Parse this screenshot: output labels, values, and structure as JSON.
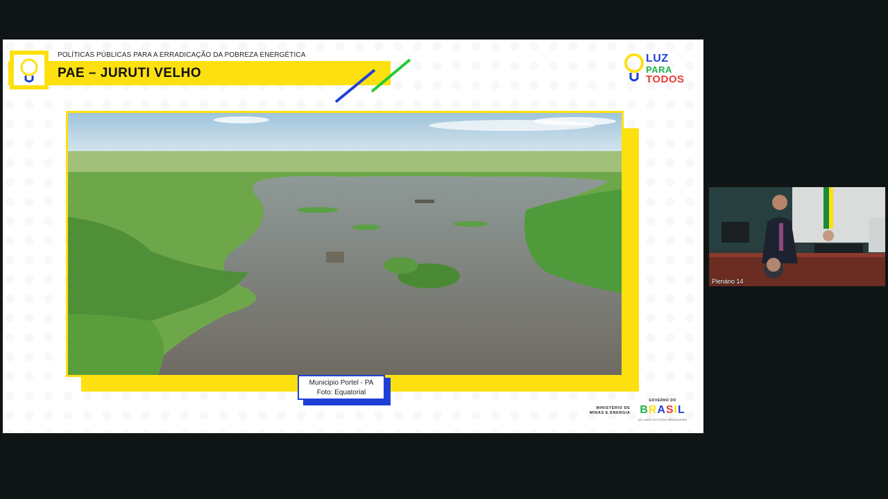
{
  "slide": {
    "subtitle": "POLÍTICAS PÚBLICAS PARA A ERRADICAÇÃO DA POBREZA ENERGÉTICA",
    "title": "PAE – JURUTI VELHO",
    "brand": {
      "line1": "LUZ",
      "line2": "PARA",
      "line3": "TODOS",
      "colors": {
        "blue": "#1e3fd6",
        "green": "#22b14c",
        "red": "#e53935",
        "yellow": "#fde010"
      }
    },
    "photo": {
      "icon": "landscape-photo",
      "caption_line1": "Municipio Portel - PA",
      "caption_line2": "Foto: Equatorial"
    },
    "footer": {
      "ministry_line1": "MINISTÉRIO DE",
      "ministry_line2": "MINAS E ENERGIA",
      "gov_top": "GOVERNO DO",
      "gov_name": "BRASIL",
      "gov_bottom": "DO LADO DO POVO BRASILEIRO"
    }
  },
  "video": {
    "label": "Plenário 14"
  }
}
